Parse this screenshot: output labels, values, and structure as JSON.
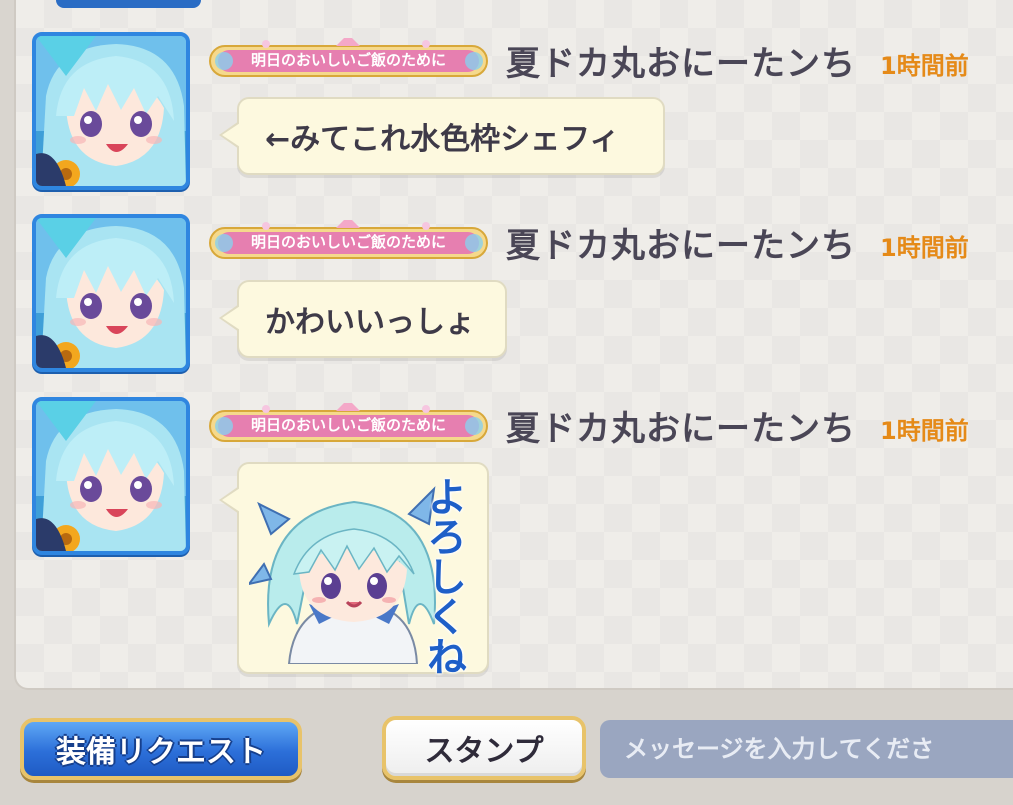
{
  "messages": [
    {
      "title_badge": "明日のおいしいご飯のために",
      "username": "夏ドカ丸おにーたンち",
      "time": "1時間前",
      "text": "←みてこれ水色枠シェフィ"
    },
    {
      "title_badge": "明日のおいしいご飯のために",
      "username": "夏ドカ丸おにーたンち",
      "time": "1時間前",
      "text": "かわいいっしょ"
    },
    {
      "title_badge": "明日のおいしいご飯のために",
      "username": "夏ドカ丸おにーたンち",
      "time": "1時間前",
      "stamp_text": "よろしくね",
      "stamp_icon": "chibi-character-stamp"
    }
  ],
  "toolbar": {
    "equip_request_label": "装備リクエスト",
    "stamp_label": "スタンプ",
    "message_placeholder": "メッセージを入力してくださ"
  },
  "colors": {
    "avatar_border": "#2f86e0",
    "time_text": "#e58a18",
    "bubble_bg": "#fdf9df",
    "equip_button": "#2c6fd9",
    "button_border": "#e8c36a",
    "input_bg": "#9aa6c0"
  }
}
